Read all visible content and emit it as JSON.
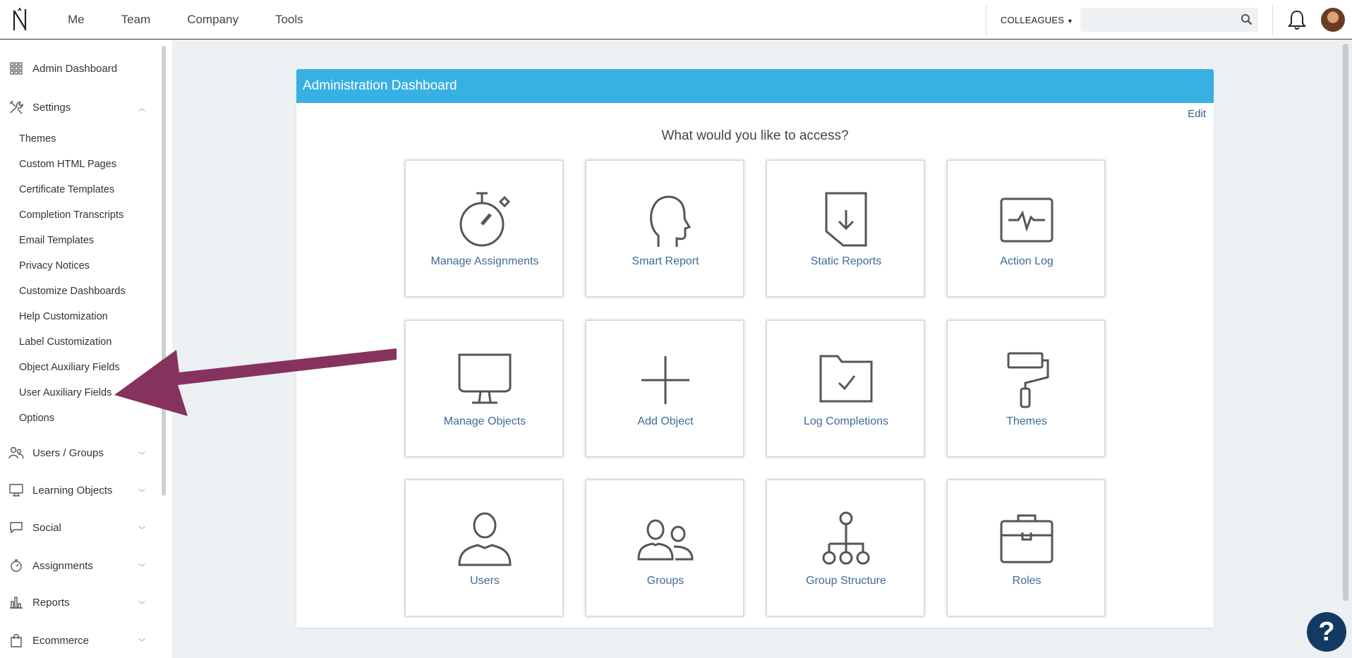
{
  "topnav": {
    "items": [
      "Me",
      "Team",
      "Company",
      "Tools"
    ],
    "colleagues_label": "COLLEAGUES",
    "search_placeholder": ""
  },
  "sidebar": {
    "admin_dashboard": "Admin Dashboard",
    "settings": "Settings",
    "settings_items": [
      "Themes",
      "Custom HTML Pages",
      "Certificate Templates",
      "Completion Transcripts",
      "Email Templates",
      "Privacy Notices",
      "Customize Dashboards",
      "Help Customization",
      "Label Customization",
      "Object Auxiliary Fields",
      "User Auxiliary Fields",
      "Options"
    ],
    "sections": [
      "Users / Groups",
      "Learning Objects",
      "Social",
      "Assignments",
      "Reports",
      "Ecommerce"
    ]
  },
  "panel": {
    "title": "Administration Dashboard",
    "edit": "Edit",
    "prompt": "What would you like to access?",
    "tiles": [
      "Manage Assignments",
      "Smart Report",
      "Static Reports",
      "Action Log",
      "Manage Objects",
      "Add Object",
      "Log Completions",
      "Themes",
      "Users",
      "Groups",
      "Group Structure",
      "Roles"
    ]
  },
  "help_button": "?",
  "colors": {
    "header_blue": "#37b0e3",
    "link_blue": "#3f6a9a",
    "arrow": "#86325e",
    "help_navy": "#133a63"
  }
}
